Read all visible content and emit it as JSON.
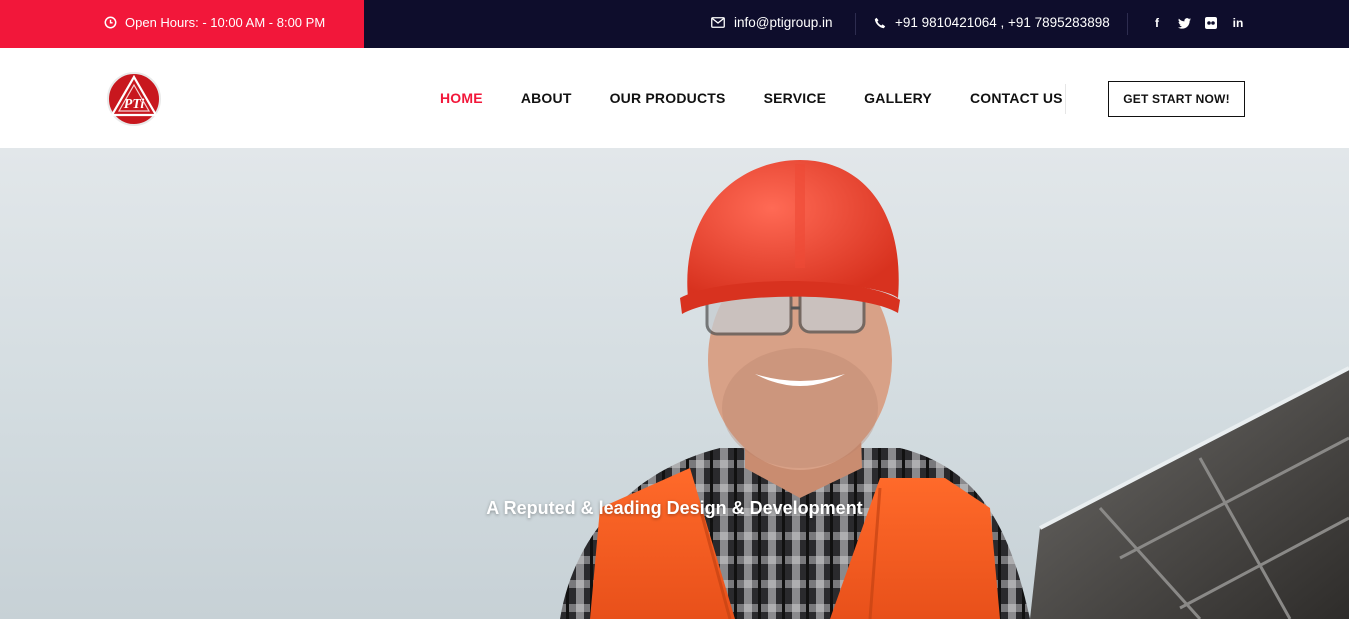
{
  "topbar": {
    "hours": "Open Hours: - 10:00 AM - 8:00 PM",
    "email": "info@ptigroup.in",
    "phone": "+91 9810421064 , +91 7895283898",
    "socials": [
      {
        "icon": "facebook-icon",
        "glyph": "f"
      },
      {
        "icon": "twitter-icon",
        "glyph": "t"
      },
      {
        "icon": "flickr-icon",
        "glyph": "••"
      },
      {
        "icon": "linkedin-icon",
        "glyph": "in"
      }
    ]
  },
  "nav": {
    "items": [
      {
        "label": "HOME",
        "active": true
      },
      {
        "label": "ABOUT"
      },
      {
        "label": "OUR PRODUCTS"
      },
      {
        "label": "SERVICE"
      },
      {
        "label": "GALLERY"
      },
      {
        "label": "CONTACT US"
      }
    ],
    "cta": "GET START NOW!"
  },
  "logo": {
    "text": "PTi"
  },
  "hero": {
    "tagline": "A Reputed & leading Design & Development"
  },
  "colors": {
    "accent": "#f2173a",
    "topbar_bg": "#0e0d2c",
    "text_dark": "#111111"
  }
}
